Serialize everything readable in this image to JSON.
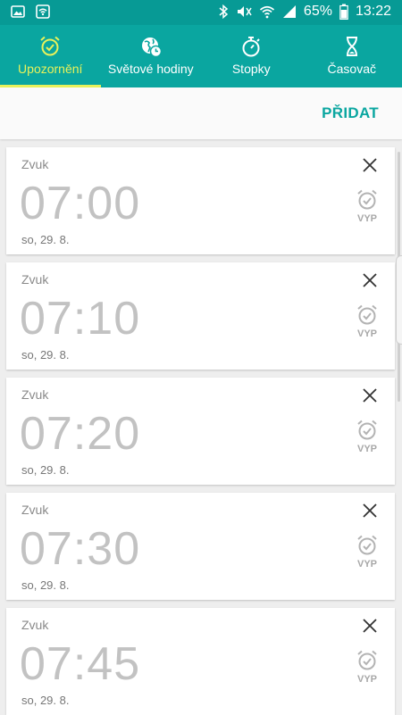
{
  "status_bar": {
    "battery_percent": "65%",
    "time": "13:22"
  },
  "tabs": [
    {
      "label": "Upozornění",
      "icon": "alarm-clock-icon",
      "active": true
    },
    {
      "label": "Světové hodiny",
      "icon": "world-clock-icon",
      "active": false
    },
    {
      "label": "Stopky",
      "icon": "stopwatch-icon",
      "active": false
    },
    {
      "label": "Časovač",
      "icon": "hourglass-icon",
      "active": false
    }
  ],
  "action_bar": {
    "add_label": "PŘIDAT"
  },
  "alarms": [
    {
      "label": "Zvuk",
      "time": "07:00",
      "date": "so, 29. 8.",
      "status": "VYP"
    },
    {
      "label": "Zvuk",
      "time": "07:10",
      "date": "so, 29. 8.",
      "status": "VYP"
    },
    {
      "label": "Zvuk",
      "time": "07:20",
      "date": "so, 29. 8.",
      "status": "VYP"
    },
    {
      "label": "Zvuk",
      "time": "07:30",
      "date": "so, 29. 8.",
      "status": "VYP"
    },
    {
      "label": "Zvuk",
      "time": "07:45",
      "date": "so, 29. 8.",
      "status": "VYP"
    }
  ],
  "colors": {
    "status_bar": "#079a95",
    "tab_bar": "#0aa6a0",
    "active_tab": "#e8f25a",
    "accent": "#0aa6a0"
  }
}
